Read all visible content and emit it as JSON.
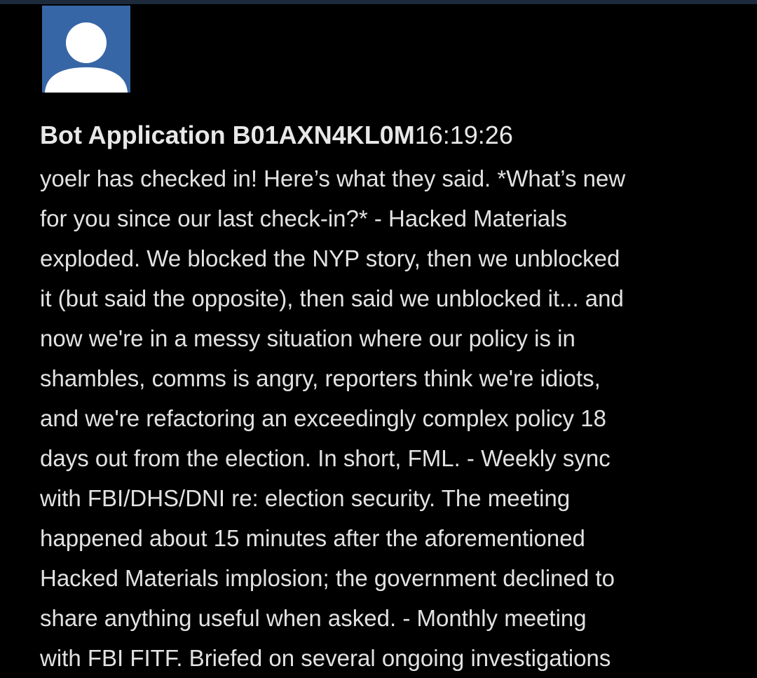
{
  "message": {
    "avatar_icon": "default-user-icon",
    "avatar_color": "#3766a6",
    "sender": "Bot Application B01AXN4KL0M",
    "timestamp": "16:19:26",
    "body_lines": [
      "yoelr has checked in! Here’s what they said. *What’s new",
      "for you since our last check-in?* - Hacked Materials",
      "exploded. We blocked the NYP story, then we unblocked",
      "it (but said the opposite), then said we unblocked it... and",
      "now we're in a messy situation where our policy is in",
      "shambles, comms is angry, reporters think we're idiots,",
      "and we're refactoring an exceedingly complex policy 18",
      "days out from the election. In short, FML. - Weekly sync",
      "with FBI/DHS/DNI re: election security. The meeting",
      "happened about 15 minutes after the aforementioned",
      "Hacked Materials implosion; the government declined to",
      "share anything useful when asked. - Monthly meeting",
      "with FBI FITF. Briefed on several ongoing investigations"
    ]
  }
}
